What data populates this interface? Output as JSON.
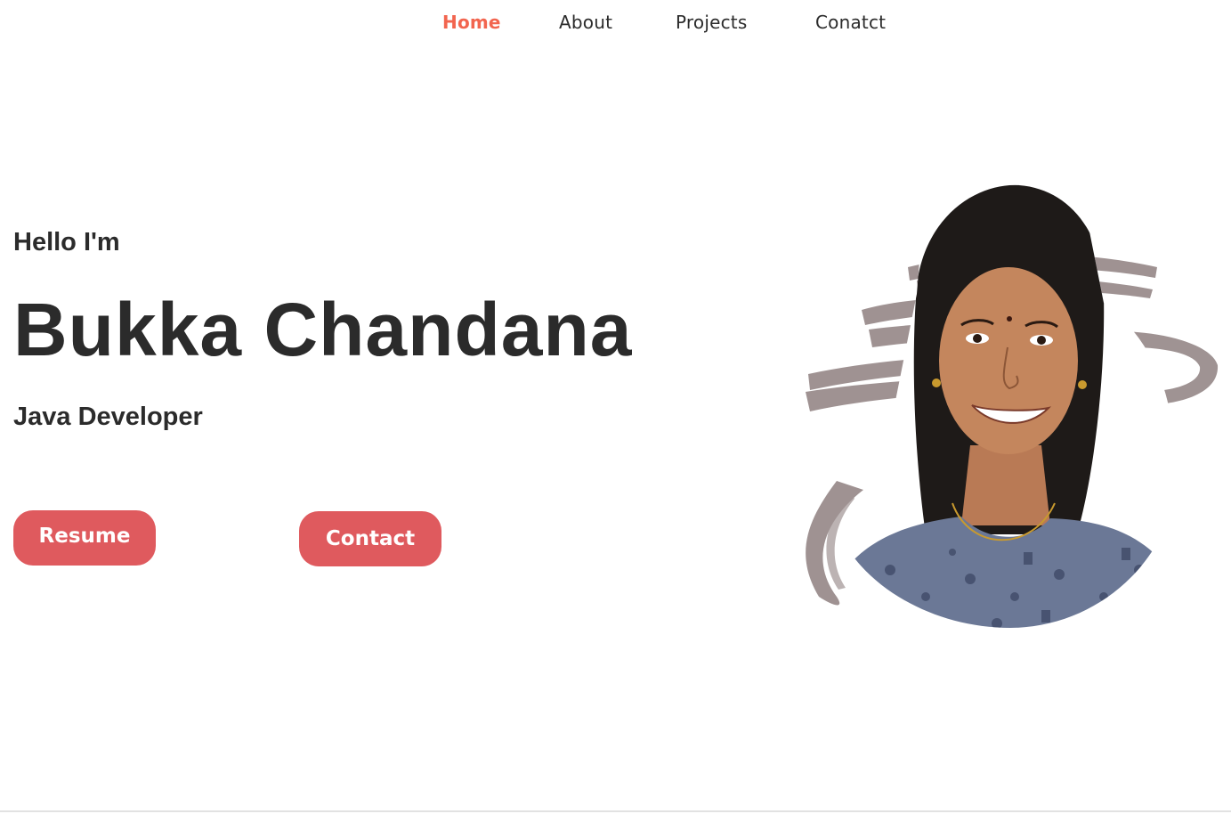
{
  "nav": {
    "items": [
      {
        "label": "Home",
        "active": true
      },
      {
        "label": "About",
        "active": false
      },
      {
        "label": "Projects",
        "active": false
      },
      {
        "label": "Conatct",
        "active": false
      }
    ],
    "active_color": "#f2654f"
  },
  "hero": {
    "greeting": "Hello I'm",
    "name": "Bukka Chandana",
    "role": "Java Developer",
    "buttons": {
      "resume_label": "Resume",
      "contact_label": "Contact"
    },
    "button_color": "#df5a5e",
    "photo_alt": "Profile photo of Bukka Chandana"
  },
  "colors": {
    "text": "#2b2b2b",
    "brush": "#9a8d8d"
  }
}
